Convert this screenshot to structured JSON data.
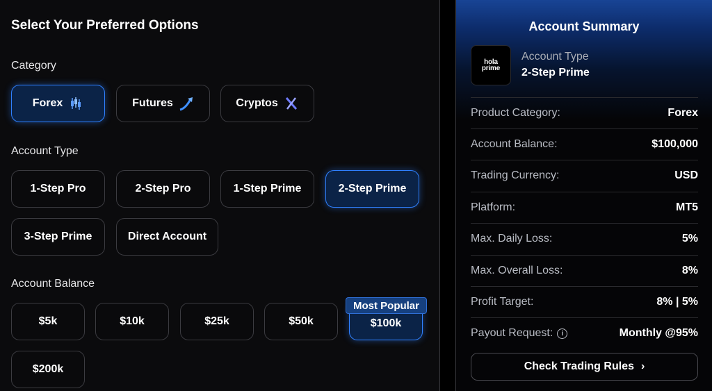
{
  "left": {
    "title": "Select Your Preferred Options",
    "category_label": "Category",
    "categories": [
      {
        "label": "Forex",
        "icon": "candlestick-icon",
        "selected": true
      },
      {
        "label": "Futures",
        "icon": "trend-arrow-icon",
        "selected": false
      },
      {
        "label": "Cryptos",
        "icon": "crypto-x-icon",
        "selected": false
      }
    ],
    "account_type_label": "Account Type",
    "account_types": [
      {
        "label": "1-Step Pro",
        "selected": false
      },
      {
        "label": "2-Step Pro",
        "selected": false
      },
      {
        "label": "1-Step Prime",
        "selected": false
      },
      {
        "label": "2-Step Prime",
        "selected": true
      },
      {
        "label": "3-Step Prime",
        "selected": false
      },
      {
        "label": "Direct Account",
        "selected": false
      }
    ],
    "account_balance_label": "Account Balance",
    "balances": [
      {
        "label": "$5k",
        "selected": false
      },
      {
        "label": "$10k",
        "selected": false
      },
      {
        "label": "$25k",
        "selected": false
      },
      {
        "label": "$50k",
        "selected": false
      },
      {
        "label": "$100k",
        "selected": true
      },
      {
        "label": "$200k",
        "selected": false
      }
    ],
    "popular_badge": "Most Popular"
  },
  "summary": {
    "title": "Account Summary",
    "logo_text_1": "hola",
    "logo_text_2": "prime",
    "account_type_label": "Account Type",
    "account_type_value": "2-Step Prime",
    "rows": [
      {
        "key": "Product Category:",
        "value": "Forex"
      },
      {
        "key": "Account Balance:",
        "value": "$100,000"
      },
      {
        "key": "Trading Currency:",
        "value": "USD"
      },
      {
        "key": "Platform:",
        "value": "MT5"
      },
      {
        "key": "Max. Daily Loss:",
        "value": "5%"
      },
      {
        "key": "Max. Overall Loss:",
        "value": "8%"
      },
      {
        "key": "Profit Target:",
        "value": "8% | 5%"
      },
      {
        "key": "Payout Request:",
        "value": "Monthly @95%"
      }
    ],
    "rules_button": "Check Trading Rules",
    "rules_chevron": "›"
  },
  "colors": {
    "accent_blue": "#2f80ff",
    "selected_bg": "#0b2347"
  }
}
